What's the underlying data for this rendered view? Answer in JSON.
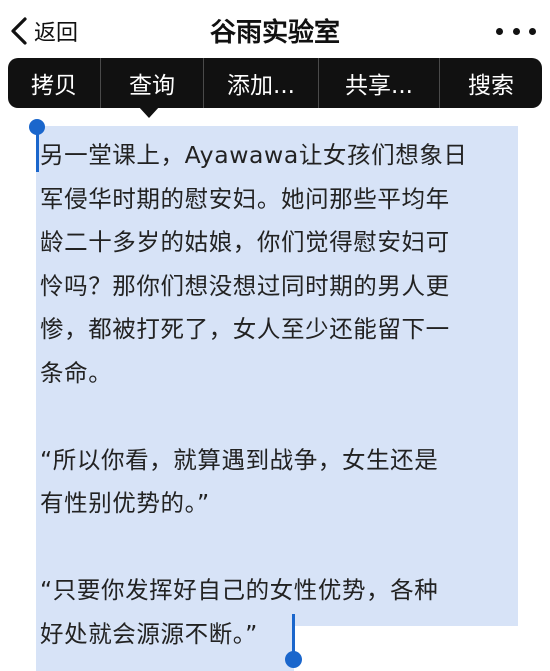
{
  "nav": {
    "back_label": "返回",
    "title": "谷雨实验室",
    "more_icon": "more-dots-icon"
  },
  "edit_menu": {
    "items": [
      "拷贝",
      "查询",
      "添加...",
      "共享...",
      "搜索"
    ]
  },
  "article": {
    "paragraphs": [
      [
        "另一堂课上，Ayawawa让女孩们想象日",
        "军侵华时期的慰安妇。她问那些平均年",
        "龄二十多岁的姑娘，你们觉得慰安妇可",
        "怜吗？那你们想没想过同时期的男人更",
        "惨，都被打死了，女人至少还能留下一",
        "条命。"
      ],
      [
        "“所以你看，就算遇到战争，女生还是",
        "有性别优势的。”"
      ],
      [
        "“只要你发挥好自己的女性优势，各种",
        "好处就会源源不断。”"
      ]
    ]
  },
  "colors": {
    "selection": "#d7e3f7",
    "handle": "#1a66cc",
    "menu_bg": "#111111"
  }
}
